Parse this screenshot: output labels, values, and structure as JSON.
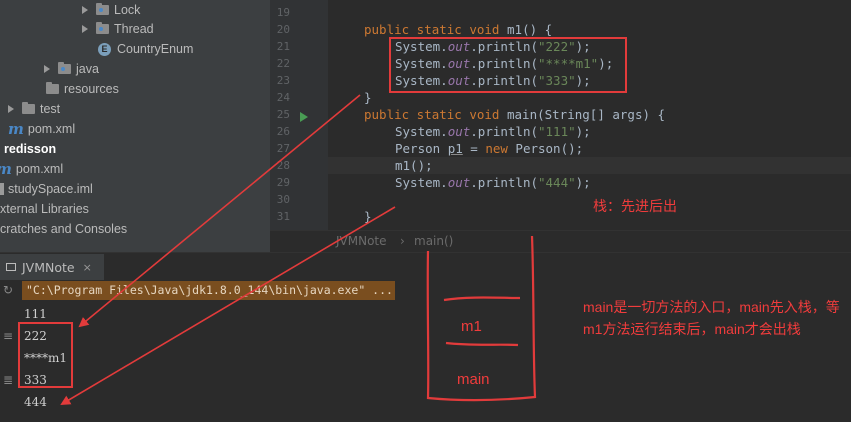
{
  "tree": {
    "items": [
      {
        "label": "Lock",
        "kind": "folder"
      },
      {
        "label": "Thread",
        "kind": "folder"
      },
      {
        "label": "CountryEnum",
        "kind": "enum",
        "badge": "E"
      },
      {
        "label": "java",
        "kind": "folder"
      },
      {
        "label": "resources",
        "kind": "folder"
      },
      {
        "label": "test",
        "kind": "folder"
      },
      {
        "label": "pom.xml",
        "kind": "maven",
        "badge": "m"
      },
      {
        "label": "redisson",
        "kind": "module"
      },
      {
        "label": "pom.xml",
        "kind": "maven",
        "badge": "m"
      },
      {
        "label": "studySpace.iml",
        "kind": "file"
      },
      {
        "label": "xternal Libraries",
        "kind": "libs"
      },
      {
        "label": "cratches and Consoles",
        "kind": "scratch"
      }
    ]
  },
  "editor": {
    "line_numbers": [
      "19",
      "20",
      "21",
      "22",
      "23",
      "24",
      "25",
      "26",
      "27",
      "28",
      "29",
      "30",
      "31"
    ],
    "l20": {
      "kw1": "public static void ",
      "name": "m1",
      "rest": "() {"
    },
    "l21": {
      "a": "System.",
      "fld": "out",
      "b": ".println(",
      "str": "\"222\"",
      "c": ");"
    },
    "l22": {
      "a": "System.",
      "fld": "out",
      "b": ".println(",
      "str": "\"****m1\"",
      "c": ");"
    },
    "l23": {
      "a": "System.",
      "fld": "out",
      "b": ".println(",
      "str": "\"333\"",
      "c": ");"
    },
    "l24": {
      "text": "}"
    },
    "l25": {
      "kw1": "public static void ",
      "name": "main",
      "rest": "(String[] args) {"
    },
    "l26": {
      "a": "System.",
      "fld": "out",
      "b": ".println(",
      "str": "\"111\"",
      "c": ");"
    },
    "l27": {
      "a": "Person ",
      "var": "p1",
      "b": " = ",
      "kw": "new",
      "c": " Person();"
    },
    "l28": {
      "text": "m1();"
    },
    "l29": {
      "a": "System.",
      "fld": "out",
      "b": ".println(",
      "str": "\"444\"",
      "c": ");"
    },
    "l31": {
      "text": "}"
    },
    "breadcrumb": {
      "class": "JVMNote",
      "sep": "›",
      "method": "main()"
    }
  },
  "run": {
    "tab_label": "JVMNote",
    "tab_close": "×",
    "command": "\"C:\\Program Files\\Java\\jdk1.8.0_144\\bin\\java.exe\" ...",
    "output": [
      "111",
      "222",
      "****m1",
      "333",
      "444"
    ]
  },
  "annotations": {
    "stack_label": "栈：先进后出",
    "note": "main是一切方法的入口，main先入栈，等m1方法运行结束后，main才会出栈",
    "frame_top": "m1",
    "frame_bottom": "main",
    "color": "#e23b3b"
  }
}
